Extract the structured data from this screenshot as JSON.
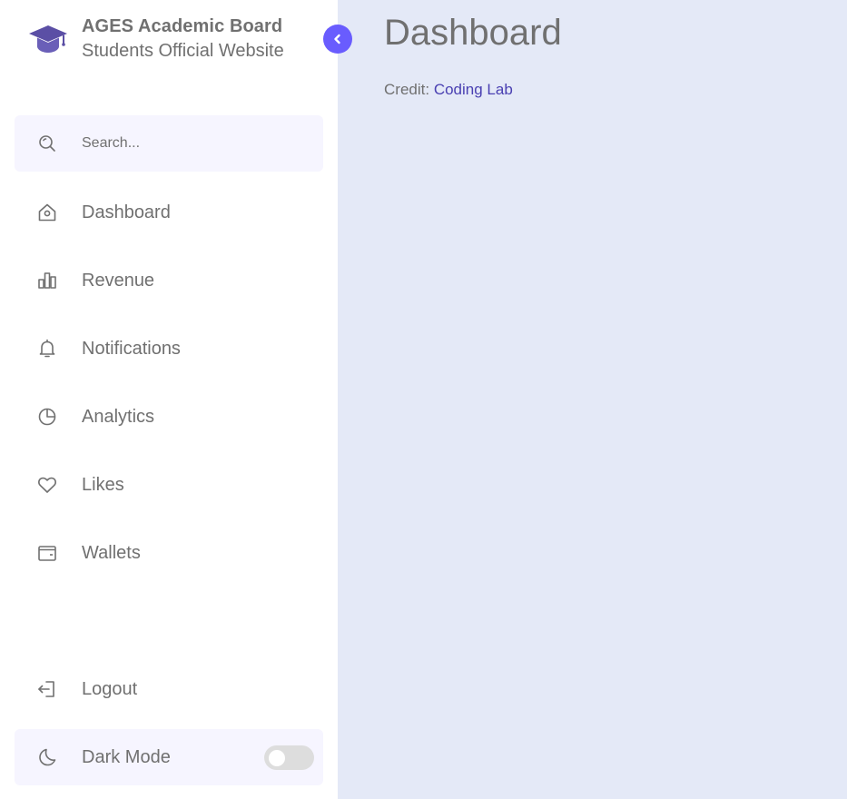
{
  "brand": {
    "name": "AGES Academic Board",
    "subtitle": "Students Official Website"
  },
  "search": {
    "placeholder": "Search..."
  },
  "nav": {
    "items": [
      {
        "label": "Dashboard",
        "icon": "home-icon"
      },
      {
        "label": "Revenue",
        "icon": "bar-chart-icon"
      },
      {
        "label": "Notifications",
        "icon": "bell-icon"
      },
      {
        "label": "Analytics",
        "icon": "pie-chart-icon"
      },
      {
        "label": "Likes",
        "icon": "heart-icon"
      },
      {
        "label": "Wallets",
        "icon": "wallet-icon"
      }
    ]
  },
  "bottom": {
    "logout": {
      "label": "Logout",
      "icon": "logout-icon"
    },
    "dark_mode": {
      "label": "Dark Mode",
      "icon": "moon-icon",
      "enabled": false
    }
  },
  "main": {
    "title": "Dashboard",
    "credit_prefix": "Credit:",
    "credit_link": "Coding Lab"
  },
  "colors": {
    "accent": "#695cfe",
    "background": "#e4e9f7",
    "sidebar": "#ffffff",
    "text": "#707070",
    "highlight": "#f6f5ff"
  }
}
